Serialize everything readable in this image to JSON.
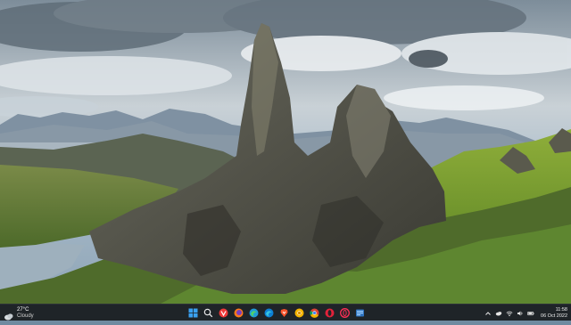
{
  "desktop": {
    "wallpaper": "Old Man of Storr landscape"
  },
  "taskbar": {
    "weather": {
      "temperature": "27°C",
      "condition": "Cloudy",
      "icon": "cloud-icon"
    },
    "apps": [
      {
        "name": "start",
        "icon": "windows-logo-icon"
      },
      {
        "name": "search",
        "icon": "search-icon"
      },
      {
        "name": "vivaldi",
        "icon": "vivaldi-icon"
      },
      {
        "name": "firefox",
        "icon": "firefox-icon"
      },
      {
        "name": "edge-beta",
        "icon": "edge-beta-icon"
      },
      {
        "name": "edge",
        "icon": "edge-icon"
      },
      {
        "name": "brave",
        "icon": "brave-icon"
      },
      {
        "name": "chrome-canary",
        "icon": "chrome-canary-icon"
      },
      {
        "name": "chrome",
        "icon": "chrome-icon"
      },
      {
        "name": "opera",
        "icon": "opera-icon"
      },
      {
        "name": "opera-gx",
        "icon": "opera-gx-icon"
      },
      {
        "name": "file-manager",
        "icon": "file-manager-icon"
      }
    ],
    "tray": {
      "icons": [
        "chevron-up-icon",
        "cloud-sync-icon",
        "network-icon",
        "volume-icon",
        "battery-icon"
      ],
      "time": "11:58",
      "date": "06 Oct 2022"
    }
  }
}
